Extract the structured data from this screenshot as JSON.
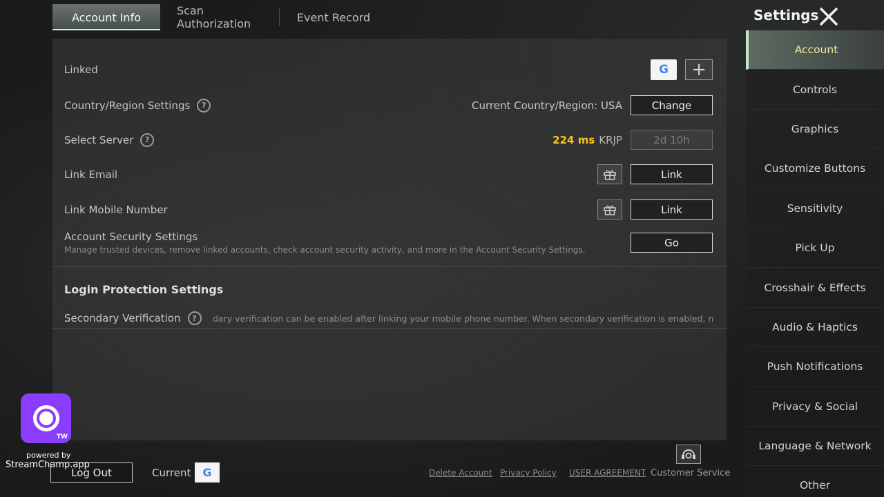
{
  "tabs": [
    {
      "label": "Account Info"
    },
    {
      "label": "Scan Authorization"
    },
    {
      "label": "Event Record"
    }
  ],
  "rows": {
    "linked": {
      "label": "Linked"
    },
    "country": {
      "label": "Country/Region Settings",
      "value": "Current Country/Region: USA",
      "button": "Change"
    },
    "server": {
      "label": "Select Server",
      "ping": "224 ms",
      "server_name": "KRJP",
      "button": "2d 10h"
    },
    "email": {
      "label": "Link Email",
      "button": "Link"
    },
    "mobile": {
      "label": "Link Mobile Number",
      "button": "Link"
    },
    "security": {
      "label": "Account Security Settings",
      "desc": "Manage trusted devices, remove linked accounts, check account security activity, and more in the Account Security Settings.",
      "button": "Go"
    },
    "login_protection": {
      "title": "Login Protection Settings"
    },
    "secondary": {
      "label": "Secondary Verification",
      "text": "dary verification can be enabled after linking your mobile phone number. When secondary verification is enabled, non-tr"
    }
  },
  "icons": {
    "google": "G",
    "plus": "+",
    "help": "?",
    "gift": "gift-icon"
  },
  "sidebar": {
    "title": "Settings",
    "items": [
      {
        "label": "Account"
      },
      {
        "label": "Controls"
      },
      {
        "label": "Graphics"
      },
      {
        "label": "Customize Buttons"
      },
      {
        "label": "Sensitivity"
      },
      {
        "label": "Pick Up"
      },
      {
        "label": "Crosshair & Effects"
      },
      {
        "label": "Audio & Haptics"
      },
      {
        "label": "Push Notifications"
      },
      {
        "label": "Privacy & Social"
      },
      {
        "label": "Language & Network"
      },
      {
        "label": "Other"
      }
    ]
  },
  "footer": {
    "logout": "Log Out",
    "current": "Current",
    "delete_account": "Delete Account",
    "privacy_policy": "Privacy Policy",
    "user_agreement": "USER AGREEMENT",
    "customer_service": "Customer Service"
  },
  "overlay": {
    "badge": "TW",
    "powered_by": "powered by",
    "app": "StreamChamp.app"
  },
  "colors": {
    "ping": "#f5c518",
    "active_tab_text": "#e9ffe9",
    "active_side_text": "#f2ea9a",
    "overlay_logo": "#8a3dff"
  }
}
